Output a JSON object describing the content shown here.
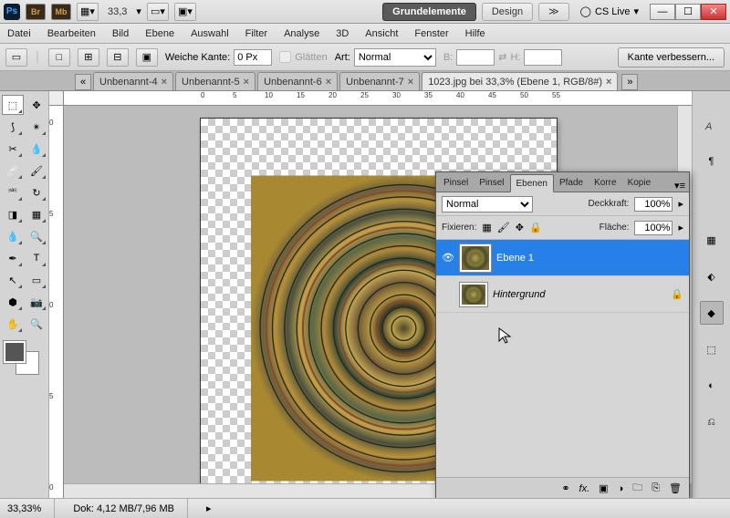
{
  "titlebar": {
    "zoom": "33,3",
    "workspace_active": "Grundelemente",
    "workspace_other": "Design",
    "cslive": "CS Live"
  },
  "menu": [
    "Datei",
    "Bearbeiten",
    "Bild",
    "Ebene",
    "Auswahl",
    "Filter",
    "Analyse",
    "3D",
    "Ansicht",
    "Fenster",
    "Hilfe"
  ],
  "optbar": {
    "soft_edge_label": "Weiche Kante:",
    "soft_edge_value": "0 Px",
    "smooth_label": "Glätten",
    "style_label": "Art:",
    "style_value": "Normal",
    "width_label": "B:",
    "height_label": "H:",
    "refine": "Kante verbessern..."
  },
  "tabs": [
    {
      "label": "Unbenannt-4"
    },
    {
      "label": "Unbenannt-5"
    },
    {
      "label": "Unbenannt-6"
    },
    {
      "label": "Unbenannt-7"
    },
    {
      "label": "1023.jpg bei 33,3% (Ebene 1, RGB/8#)",
      "active": true
    }
  ],
  "panel": {
    "tabs": [
      "Pinsel",
      "Pinsel",
      "Ebenen",
      "Pfade",
      "Korre",
      "Kopie"
    ],
    "active_tab": 2,
    "blend_mode": "Normal",
    "opacity_label": "Deckkraft:",
    "opacity": "100%",
    "lock_label": "Fixieren:",
    "fill_label": "Fläche:",
    "fill": "100%",
    "layers": [
      {
        "name": "Ebene 1",
        "visible": true,
        "selected": true,
        "locked": false
      },
      {
        "name": "Hintergrund",
        "visible": false,
        "selected": false,
        "locked": true,
        "italic": true
      }
    ]
  },
  "ruler_h": [
    "0",
    "5",
    "10",
    "15",
    "20",
    "25",
    "30",
    "35",
    "40",
    "45",
    "50",
    "55"
  ],
  "ruler_v": [
    "0",
    "5",
    "0",
    "5",
    "0"
  ],
  "status": {
    "zoom": "33,33%",
    "doc": "Dok: 4,12 MB/7,96 MB"
  }
}
